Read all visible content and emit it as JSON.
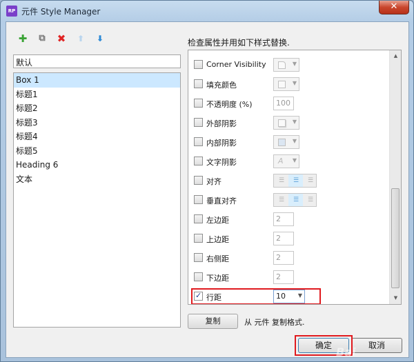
{
  "window": {
    "title": "元件 Style Manager",
    "app_icon_text": "RP",
    "close_glyph": "✕"
  },
  "toolbar": {
    "add_glyph": "✚",
    "copy_glyph": "⧉",
    "delete_glyph": "✖",
    "up_glyph": "⬆",
    "down_glyph": "⬇"
  },
  "style_name_value": "默认",
  "styles": [
    "Box 1",
    "标题1",
    "标题2",
    "标题3",
    "标题4",
    "标题5",
    "Heading 6",
    "文本"
  ],
  "header_text": "检查属性并用如下样式替换.",
  "props": {
    "corner_visibility": "Corner Visibility",
    "fill_color": "填充颜色",
    "opacity": "不透明度 (%)",
    "opacity_value": "100",
    "outer_shadow": "外部阴影",
    "inner_shadow": "内部阴影",
    "text_shadow": "文字阴影",
    "text_shadow_glyph": "A",
    "align": "对齐",
    "valign": "垂直对齐",
    "left_padding": "左边距",
    "left_padding_value": "2",
    "top_padding": "上边距",
    "top_padding_value": "2",
    "right_padding": "右侧距",
    "right_padding_value": "2",
    "bottom_padding": "下边距",
    "bottom_padding_value": "2",
    "line_spacing": "行距",
    "line_spacing_value": "10",
    "check_glyph": "✓",
    "arrow_glyph": "▼"
  },
  "copy_button": "复制",
  "copy_text": "从 元件 复制格式.",
  "ok_button": "确定",
  "cancel_button": "取消",
  "watermark_text": "Bai"
}
